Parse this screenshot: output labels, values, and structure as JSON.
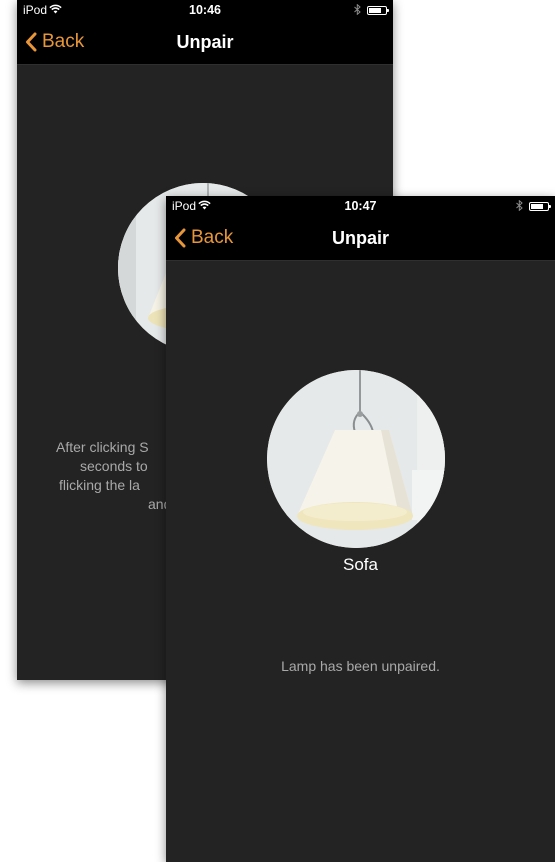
{
  "back_screen": {
    "status_bar": {
      "carrier": "iPod",
      "time": "10:46"
    },
    "nav": {
      "back_label": "Back",
      "title": "Unpair"
    },
    "instruction_lines": [
      "After clicking S",
      "seconds to",
      "flicking the la",
      "and"
    ]
  },
  "front_screen": {
    "status_bar": {
      "carrier": "iPod",
      "time": "10:47"
    },
    "nav": {
      "back_label": "Back",
      "title": "Unpair"
    },
    "lamp_name": "Sofa",
    "status_message": "Lamp has been unpaired."
  },
  "colors": {
    "accent": "#e8963a",
    "background": "#232323",
    "bar": "#000000",
    "muted_text": "#a9a9a9"
  },
  "icons": [
    "wifi-icon",
    "bluetooth-icon",
    "battery-icon",
    "chevron-left-icon"
  ]
}
